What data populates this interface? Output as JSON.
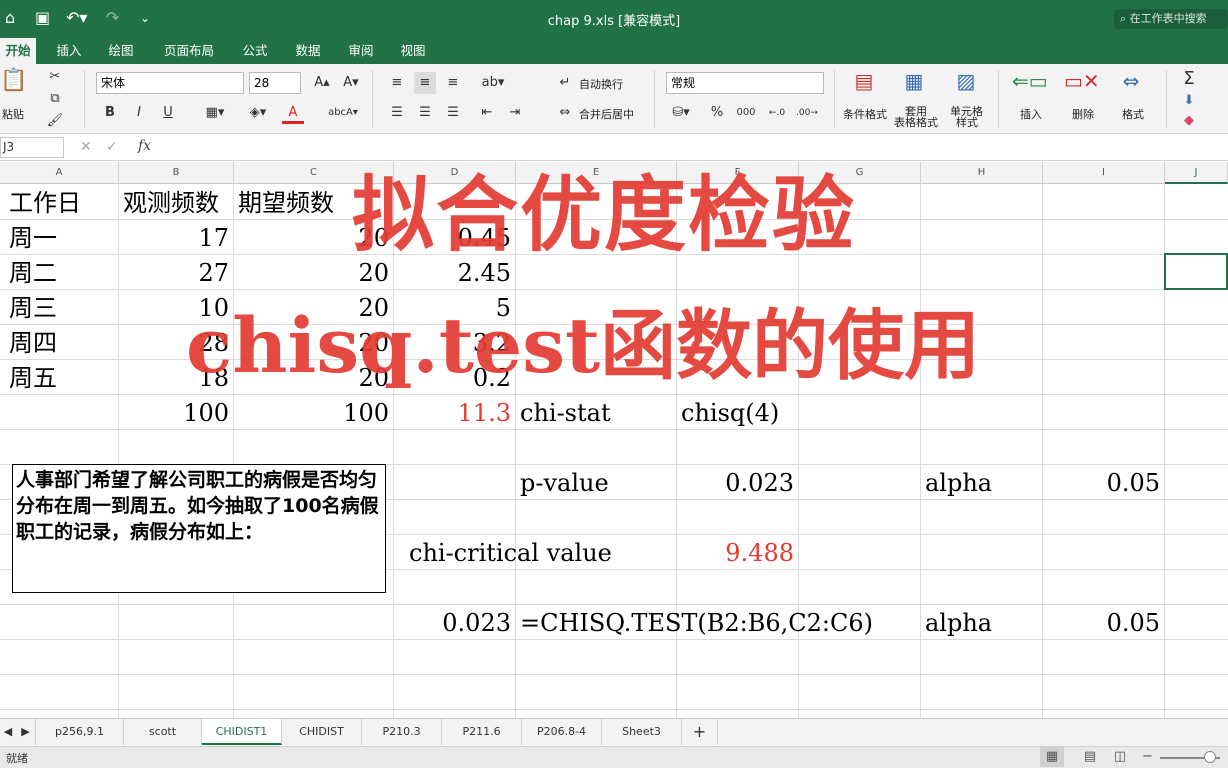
{
  "titlebar": {
    "title": "chap 9.xls [兼容模式]",
    "search_placeholder": "在工作表中搜索",
    "icons": [
      "home-icon",
      "save-icon",
      "undo-icon",
      "redo-icon",
      "customize-icon"
    ]
  },
  "menu_tabs": [
    "开始",
    "插入",
    "绘图",
    "页面布局",
    "公式",
    "数据",
    "审阅",
    "视图"
  ],
  "ribbon": {
    "paste_label": "粘贴",
    "font_name": "宋体",
    "font_size": "28",
    "wrap_text": "自动换行",
    "merge_center": "合并后居中",
    "number_format": "常规",
    "percent": "%",
    "thousands": "000",
    "conditional_format": "条件格式",
    "table_format_1": "套用",
    "table_format_2": "表格格式",
    "cell_style_1": "单元格",
    "cell_style_2": "样式",
    "insert": "插入",
    "delete": "删除",
    "format": "格式",
    "bold": "B",
    "italic": "I",
    "underline": "U",
    "font_color_a": "A"
  },
  "formula_bar": {
    "name_box": "J3",
    "fx": "fx",
    "content": ""
  },
  "columns": [
    "A",
    "B",
    "C",
    "D",
    "E",
    "F",
    "G",
    "H",
    "I",
    "J"
  ],
  "cells": {
    "a1": "工作日",
    "b1": "观测频数",
    "c1": "期望频数",
    "a2": "周一",
    "b2": "17",
    "c2": "20",
    "d2": "0.45",
    "a3": "周二",
    "b3": "27",
    "c3": "20",
    "d3": "2.45",
    "a4": "周三",
    "b4": "10",
    "c4": "20",
    "d4": "5",
    "a5": "周四",
    "b5": "28",
    "c5": "20",
    "d5": "3.2",
    "a6": "周五",
    "b6": "18",
    "c6": "20",
    "d6": "0.2",
    "b7": "100",
    "c7": "100",
    "d7": "11.3",
    "e7": "chi-stat",
    "f7": "chisq(4)",
    "e9": "p-value",
    "f9": "0.023",
    "h9": "alpha",
    "i9": "0.05",
    "d11": "chi-critical value",
    "f11": "9.488",
    "d13": "0.023",
    "e13": "=CHISQ.TEST(B2:B6,C2:C6)",
    "h13": "alpha",
    "i13": "0.05"
  },
  "textbox": "人事部门希望了解公司职工的病假是否均匀分布在周一到周五。如今抽取了100名病假职工的记录，病假分布如上：",
  "overlay": {
    "title": "拟合优度检验",
    "subtitle": "chisq.test函数的使用"
  },
  "sheet_tabs": [
    "p256,9.1",
    "scott",
    "CHIDIST1",
    "CHIDIST",
    "P210.3",
    "P211.6",
    "P206.8-4",
    "Sheet3"
  ],
  "add_sheet": "+",
  "status": "就绪",
  "colors": {
    "excel_green": "#217346",
    "overlay_red": "#e23c34",
    "cell_red": "#e33b2e"
  }
}
